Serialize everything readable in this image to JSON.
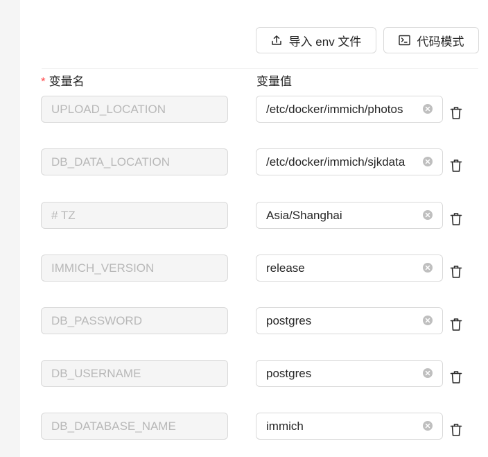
{
  "toolbar": {
    "import_label": "导入 env 文件",
    "code_mode_label": "代码模式"
  },
  "headers": {
    "required_mark": "*",
    "name": "变量名",
    "value": "变量值"
  },
  "rows": [
    {
      "name": "UPLOAD_LOCATION",
      "value": "/etc/docker/immich/photos"
    },
    {
      "name": "DB_DATA_LOCATION",
      "value": "/etc/docker/immich/sjkdata"
    },
    {
      "name": "# TZ",
      "value": "Asia/Shanghai"
    },
    {
      "name": "IMMICH_VERSION",
      "value": "release"
    },
    {
      "name": "DB_PASSWORD",
      "value": "postgres"
    },
    {
      "name": "DB_USERNAME",
      "value": "postgres"
    },
    {
      "name": "DB_DATABASE_NAME",
      "value": "immich"
    }
  ],
  "icons": {
    "import": "upload-icon",
    "code_mode": "terminal-icon",
    "clear": "clear-circle-icon",
    "delete": "trash-icon"
  },
  "colors": {
    "required": "#ff4d4f",
    "border": "#d9d9d9",
    "disabled_bg": "#f5f5f5",
    "disabled_text": "#b8b8b8"
  }
}
